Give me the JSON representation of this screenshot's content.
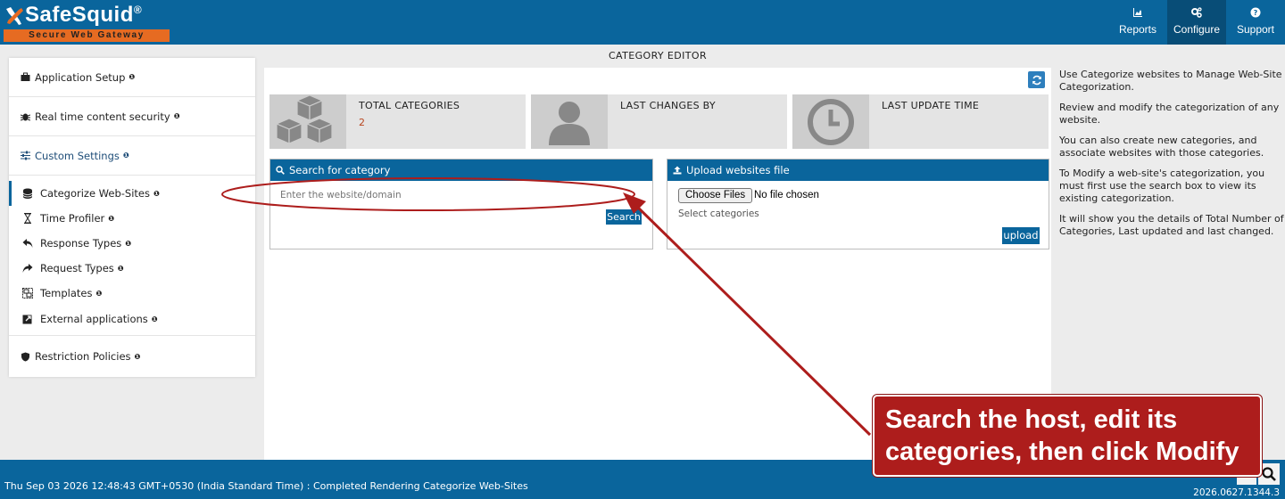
{
  "header": {
    "logo_text": "SafeSquid",
    "logo_reg": "®",
    "logo_tagline": "Secure Web Gateway",
    "nav": [
      {
        "label": "Reports",
        "icon": "area-chart-icon",
        "active": false
      },
      {
        "label": "Configure",
        "icon": "gears-icon",
        "active": true
      },
      {
        "label": "Support",
        "icon": "question-circle-icon",
        "active": false
      }
    ]
  },
  "sidebar": {
    "groups": [
      {
        "label": "Application Setup",
        "icon": "briefcase-icon"
      },
      {
        "label": "Real time content security",
        "icon": "bug-icon"
      },
      {
        "label": "Custom Settings",
        "icon": "sliders-icon"
      },
      {
        "label": "Restriction Policies",
        "icon": "shield-icon"
      }
    ],
    "info_mark": "❶",
    "sub_items": [
      {
        "label": "Categorize Web-Sites",
        "icon": "database-icon",
        "active": true
      },
      {
        "label": "Time Profiler",
        "icon": "hourglass-icon",
        "active": false
      },
      {
        "label": "Response Types",
        "icon": "reply-icon",
        "active": false
      },
      {
        "label": "Request Types",
        "icon": "share-icon",
        "active": false
      },
      {
        "label": "Templates",
        "icon": "object-group-icon",
        "active": false
      },
      {
        "label": "External applications",
        "icon": "external-link-icon",
        "active": false
      }
    ]
  },
  "main": {
    "title": "CATEGORY EDITOR",
    "cards": [
      {
        "title": "TOTAL CATEGORIES",
        "value": "2",
        "icon": "cubes-icon"
      },
      {
        "title": "LAST CHANGES BY",
        "value": "",
        "icon": "user-icon"
      },
      {
        "title": "LAST UPDATE TIME",
        "value": "",
        "icon": "clock-icon"
      }
    ],
    "search_panel": {
      "title": "Search for category",
      "placeholder": "Enter the website/domain",
      "button": "Search"
    },
    "upload_panel": {
      "title": "Upload websites file",
      "choose_label": "Choose Files",
      "no_file": "No file chosen",
      "select_categories": "Select categories",
      "button": "upload"
    }
  },
  "help": [
    "Use Categorize websites to Manage Web-Site Categorization.",
    "Review and modify the categorization of any website.",
    "You can also create new categories, and associate websites with those categories.",
    "To Modify a web-site's categorization, you must first use the search box to view its existing categorization.",
    "It will show you the details of Total Number of Categories, Last updated and last changed."
  ],
  "footer": {
    "status": "Thu Sep 03 2026 12:48:43 GMT+0530 (India Standard Time) : Completed Rendering Categorize Web-Sites",
    "version": "2026.0627.1344.3"
  },
  "annotation": {
    "line1": "Search the host, edit its",
    "line2": "categories, then click Modify",
    "color": "#ad1d1c"
  },
  "colors": {
    "brand_blue": "#0a659c",
    "brand_orange": "#e66b22",
    "value_red": "#b8461f"
  }
}
